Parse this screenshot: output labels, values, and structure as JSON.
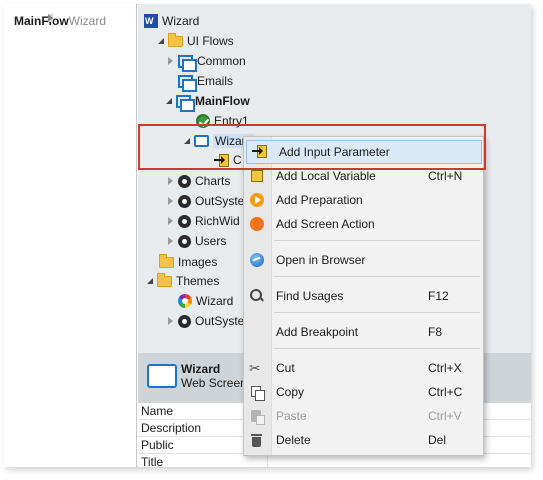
{
  "breadcrumb": {
    "root": "MainFlow",
    "current": "Wizard"
  },
  "tree": {
    "app": "Wizard",
    "ui_flows": "UI Flows",
    "common": "Common",
    "emails": "Emails",
    "mainflow": "MainFlow",
    "entry": "Entry1",
    "wizard_screen": "Wizard",
    "input_param_partial": "C",
    "charts": "Charts",
    "outsystems_1": "OutSyste",
    "richwidgets": "RichWid",
    "users": "Users",
    "images": "Images",
    "themes": "Themes",
    "wizard_theme": "Wizard",
    "outsystems_2": "OutSyste"
  },
  "details": {
    "title": "Wizard",
    "subtitle": "Web Screen",
    "properties": [
      "Name",
      "Description",
      "Public",
      "Title"
    ]
  },
  "context_menu": {
    "add_input_parameter": "Add Input Parameter",
    "add_local_variable": "Add Local Variable",
    "add_local_variable_shortcut": "Ctrl+N",
    "add_preparation": "Add Preparation",
    "add_screen_action": "Add Screen Action",
    "open_in_browser": "Open in Browser",
    "find_usages": "Find Usages",
    "find_usages_shortcut": "F12",
    "add_breakpoint": "Add Breakpoint",
    "add_breakpoint_shortcut": "F8",
    "cut": "Cut",
    "cut_shortcut": "Ctrl+X",
    "copy": "Copy",
    "copy_shortcut": "Ctrl+C",
    "paste": "Paste",
    "paste_shortcut": "Ctrl+V",
    "delete": "Delete",
    "delete_shortcut": "Del"
  },
  "colors": {
    "highlight_border": "#cc3b2a",
    "accent_blue": "#1f73c6",
    "panel_bg": "#e8ebee",
    "menu_hover": "#dbe8f5"
  }
}
